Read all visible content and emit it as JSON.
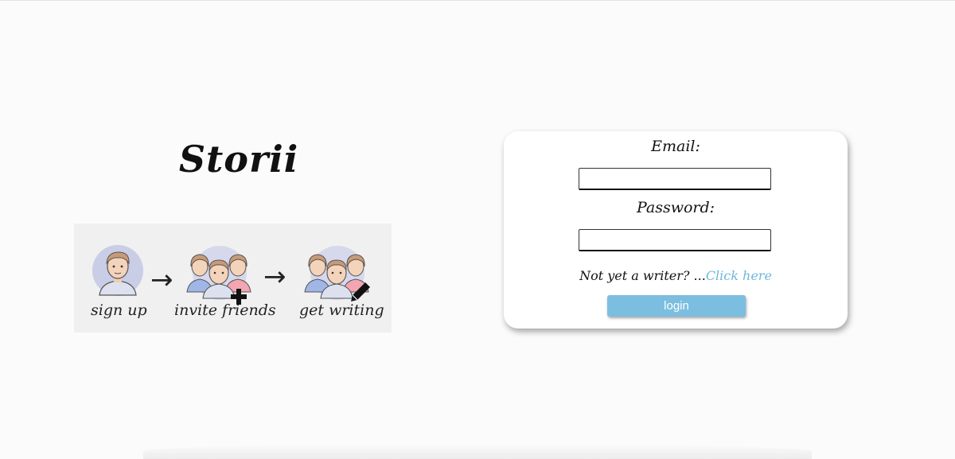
{
  "brand": {
    "title": "Storii"
  },
  "steps": [
    {
      "label": "sign up",
      "icon": "single-user-icon"
    },
    {
      "label": "invite friends",
      "icon": "group-add-icon"
    },
    {
      "label": "get writing",
      "icon": "group-edit-icon"
    }
  ],
  "arrows": {
    "glyph": "→"
  },
  "login": {
    "email_label": "Email:",
    "email_value": "",
    "password_label": "Password:",
    "password_value": "",
    "signup_prompt": "Not yet a writer? ...",
    "signup_link": "Click here",
    "button_label": "login"
  },
  "colors": {
    "accent": "#7cbedf",
    "link": "#6fb7dc",
    "background": "#fbfbfb",
    "card": "#ffffff"
  }
}
